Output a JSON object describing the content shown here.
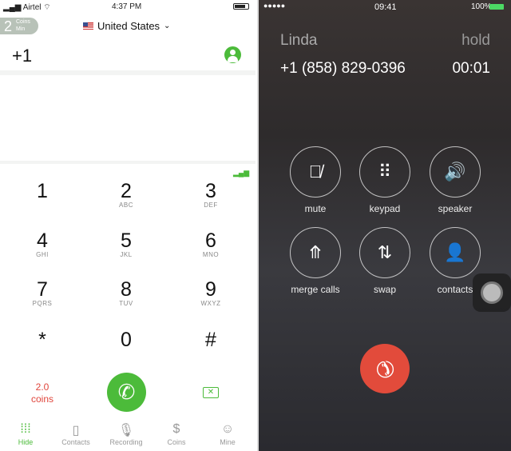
{
  "left": {
    "status": {
      "carrier": "Airtel",
      "time": "4:37 PM"
    },
    "coins_badge": {
      "value": "2",
      "line1": "Coins",
      "line2": "Min"
    },
    "country": "United States",
    "dial_prefix": "+1",
    "keys": [
      {
        "d": "1",
        "l": ""
      },
      {
        "d": "2",
        "l": "ABC"
      },
      {
        "d": "3",
        "l": "DEF"
      },
      {
        "d": "4",
        "l": "GHI"
      },
      {
        "d": "5",
        "l": "JKL"
      },
      {
        "d": "6",
        "l": "MNO"
      },
      {
        "d": "7",
        "l": "PQRS"
      },
      {
        "d": "8",
        "l": "TUV"
      },
      {
        "d": "9",
        "l": "WXYZ"
      },
      {
        "d": "*",
        "l": ""
      },
      {
        "d": "0",
        "l": ""
      },
      {
        "d": "#",
        "l": ""
      }
    ],
    "rate": {
      "value": "2.0",
      "unit": "coins"
    },
    "tabs": [
      {
        "label": "Hide",
        "icon": "keypad-icon"
      },
      {
        "label": "Contacts",
        "icon": "contacts-book-icon"
      },
      {
        "label": "Recording",
        "icon": "microphone-icon"
      },
      {
        "label": "Coins",
        "icon": "dollar-coin-icon"
      },
      {
        "label": "Mine",
        "icon": "profile-icon"
      }
    ],
    "colors": {
      "accent": "#4cbb3a",
      "rate": "#e0463c"
    }
  },
  "right": {
    "status": {
      "time": "09:41",
      "battery": "100%"
    },
    "caller": "Linda",
    "state": "hold",
    "number": "+1 (858) 829-0396",
    "duration": "00:01",
    "buttons": [
      {
        "label": "mute"
      },
      {
        "label": "keypad"
      },
      {
        "label": "speaker"
      },
      {
        "label": "merge calls"
      },
      {
        "label": "swap"
      },
      {
        "label": "contacts"
      }
    ],
    "colors": {
      "end_call": "#e24b3b"
    }
  }
}
